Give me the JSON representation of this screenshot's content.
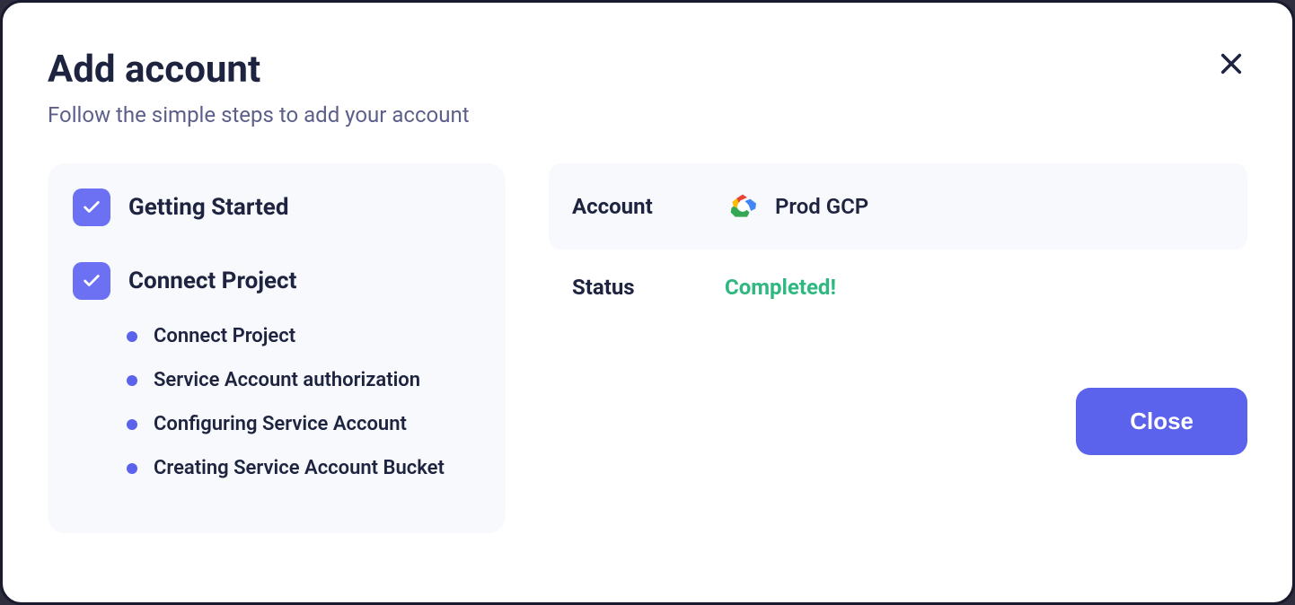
{
  "modal": {
    "title": "Add account",
    "subtitle": "Follow the simple steps to add your account"
  },
  "steps": {
    "s1": {
      "title": "Getting Started"
    },
    "s2": {
      "title": "Connect Project",
      "sub": {
        "a": "Connect Project",
        "b": "Service Account authorization",
        "c": "Configuring Service Account",
        "d": "Creating Service Account Bucket"
      }
    }
  },
  "details": {
    "account_label": "Account",
    "account_value": "Prod GCP",
    "status_label": "Status",
    "status_value": "Completed!"
  },
  "actions": {
    "close": "Close"
  }
}
